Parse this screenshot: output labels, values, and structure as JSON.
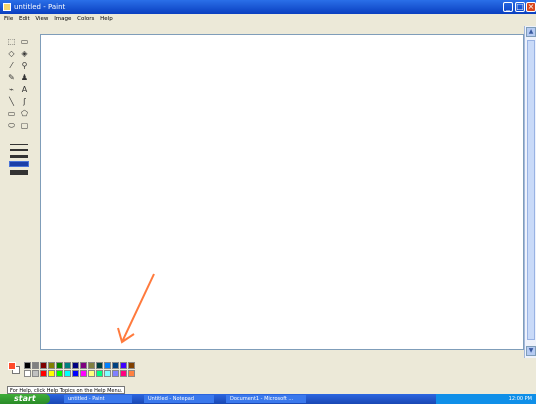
{
  "window": {
    "title": "untitled - Paint"
  },
  "menu": {
    "items": [
      "File",
      "Edit",
      "View",
      "Image",
      "Colors",
      "Help"
    ]
  },
  "tools": [
    {
      "name": "free-form-select-icon",
      "glyph": "⬚"
    },
    {
      "name": "select-icon",
      "glyph": "▭"
    },
    {
      "name": "eraser-icon",
      "glyph": "◇"
    },
    {
      "name": "fill-icon",
      "glyph": "◈"
    },
    {
      "name": "pick-color-icon",
      "glyph": "⁄"
    },
    {
      "name": "magnifier-icon",
      "glyph": "⚲"
    },
    {
      "name": "pencil-icon",
      "glyph": "✎"
    },
    {
      "name": "brush-icon",
      "glyph": "♟"
    },
    {
      "name": "airbrush-icon",
      "glyph": "⌁"
    },
    {
      "name": "text-icon",
      "glyph": "A"
    },
    {
      "name": "line-icon",
      "glyph": "╲"
    },
    {
      "name": "curve-icon",
      "glyph": "ʃ"
    },
    {
      "name": "rectangle-icon",
      "glyph": "▭"
    },
    {
      "name": "polygon-icon",
      "glyph": "⬠"
    },
    {
      "name": "ellipse-icon",
      "glyph": "⬭"
    },
    {
      "name": "rounded-rect-icon",
      "glyph": "▢"
    }
  ],
  "palette": {
    "top": [
      "#000000",
      "#808080",
      "#800000",
      "#808000",
      "#008000",
      "#008080",
      "#000080",
      "#800080",
      "#808040",
      "#004040",
      "#0080ff",
      "#004080",
      "#4000ff",
      "#804000"
    ],
    "bottom": [
      "#ffffff",
      "#c0c0c0",
      "#ff0000",
      "#ffff00",
      "#00ff00",
      "#00ffff",
      "#0000ff",
      "#ff00ff",
      "#ffff80",
      "#00ff80",
      "#80ffff",
      "#8080ff",
      "#ff0080",
      "#ff8040"
    ]
  },
  "status": {
    "text": "For Help, click Help Topics on the Help Menu."
  },
  "taskbar": {
    "start_label": "start",
    "tasks": [
      "untitled - Paint",
      "Untitled - Notepad",
      "Document1 - Microsoft ..."
    ],
    "tray_time": "12:00 PM"
  },
  "colors": {
    "annotation_arrow": "#ff7a3d"
  }
}
